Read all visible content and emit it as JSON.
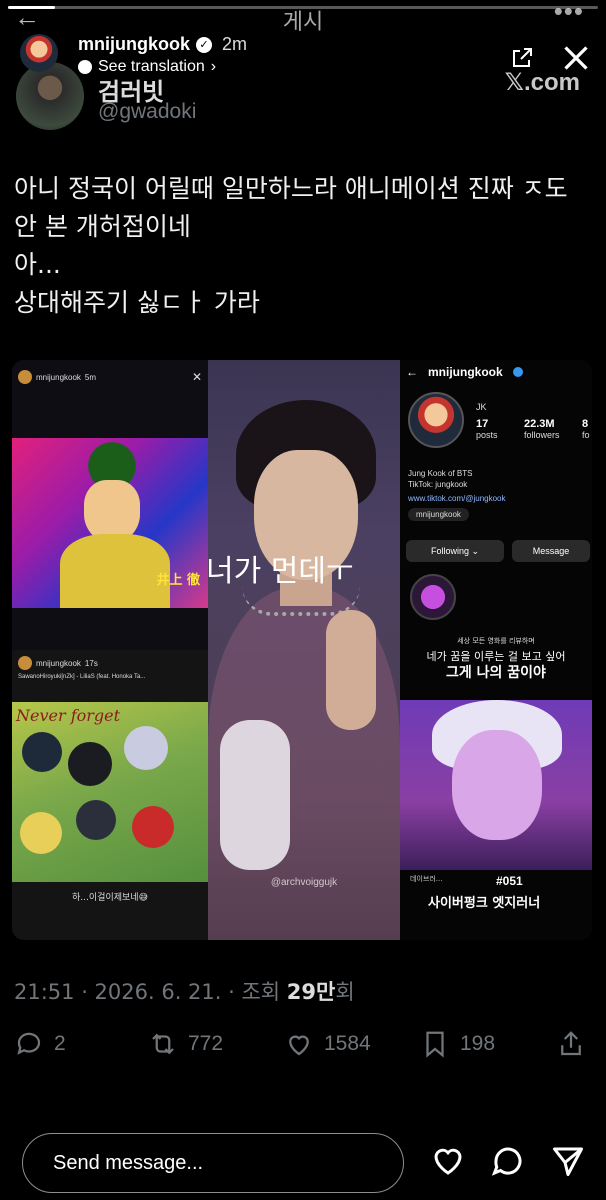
{
  "tweet": {
    "nav_back": "←",
    "nav_title": "게시",
    "nav_more": "•••",
    "display_name": "검러빗",
    "handle": "@gwadoki",
    "source_logo": "𝕏.com",
    "text_lines": [
      "아니 정국이 어릴때 일만하느라 애니메이션 진짜 ㅈ도",
      "안 본 개허접이네",
      "아...",
      "상대해주기 싫ㄷㅏ 가라"
    ],
    "collage": {
      "left_top": {
        "account": "mnijungkook",
        "age": "5m",
        "caption": "井上 徹",
        "close": "✕"
      },
      "left_bottom": {
        "account": "mnijungkook",
        "age": "17s",
        "music": "SawanoHiroyuki[nZk] - LiliaS (feat. Honoka Ta...",
        "script": "Never forget",
        "caption": "하...이걸이제보네😅"
      },
      "center": {
        "overlay_text": "너가 먼데ㅜ",
        "credit": "@archvoiggujk"
      },
      "right": {
        "username": "mnijungkook",
        "posts_value": "17",
        "posts_label": "posts",
        "followers_value": "22.3M",
        "followers_label": "followers",
        "following_value": "8",
        "following_label": "fo",
        "initials": "JK",
        "bio_line1": "Jung Kook of BTS",
        "bio_line2": "TikTok: jungkook",
        "link": "www.tiktok.com/@jungkook",
        "pill": "mnijungkook",
        "following_button": "Following ⌄",
        "message_button": "Message",
        "subtitle_small": "세상 모든 영화를 리뷰하며",
        "subtitle_mid": "네가 꿈을 이루는 걸 보고 싶어",
        "subtitle_big": "그게 나의 꿈이야",
        "episode": "#051",
        "episode_title": "사이버펑크 엣지러너",
        "tiny_label": "데이브러..."
      }
    },
    "meta_time": "21:51 · 2026. 6. 21. · 조회 ",
    "meta_views": "29만",
    "meta_suffix": "회",
    "replies": "2",
    "retweets": "772",
    "likes": "1584",
    "bookmarks": "198"
  },
  "story": {
    "progress": 0.08,
    "username": "mnijungkook",
    "time": "2m",
    "see_translation": "See translation",
    "message_placeholder": "Send message..."
  },
  "colors": {
    "background": "#000000",
    "muted": "#71767b",
    "ig_border": "#8e8e8e"
  }
}
